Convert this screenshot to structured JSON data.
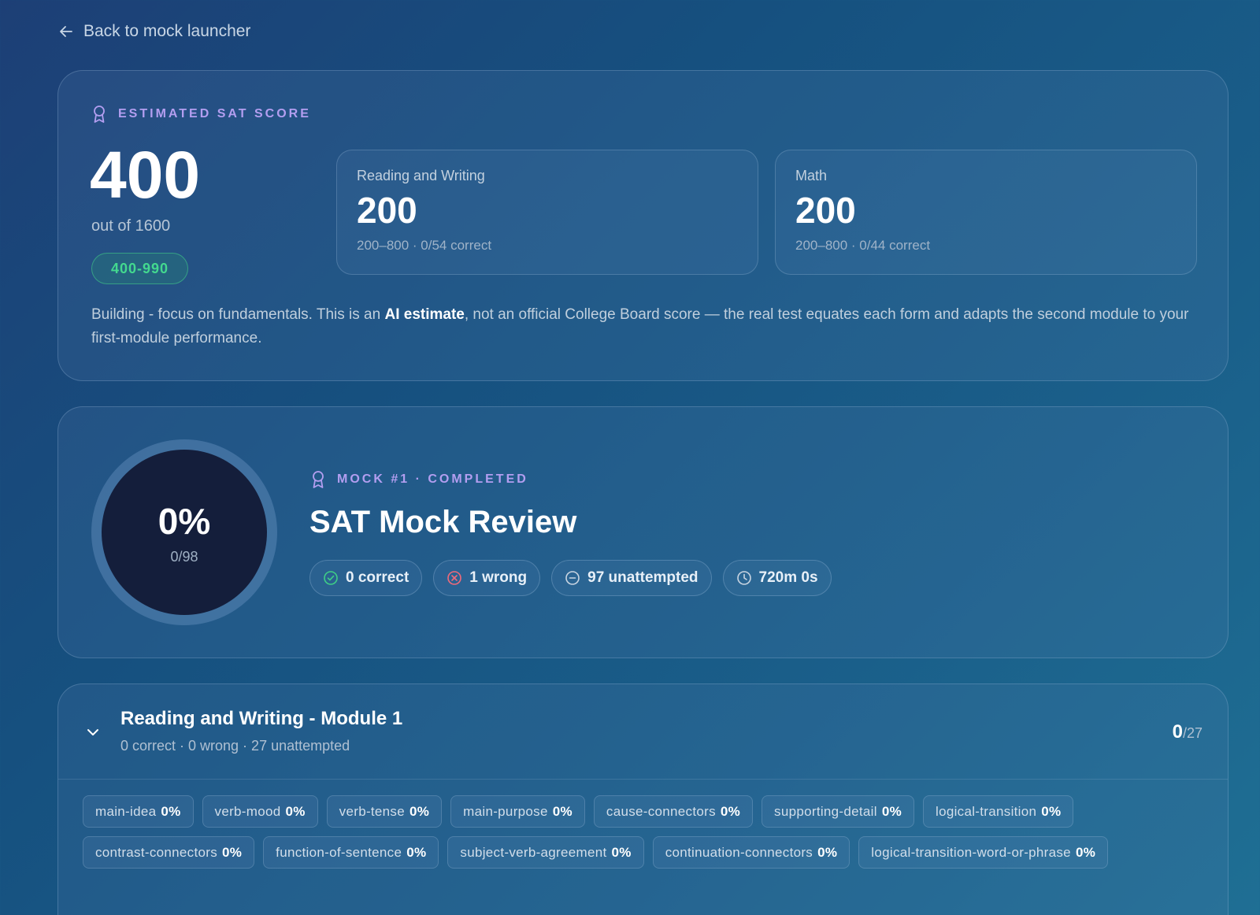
{
  "nav": {
    "back_label": "Back to mock launcher"
  },
  "score": {
    "eyebrow": "ESTIMATED SAT SCORE",
    "total": "400",
    "out_of": "out of 1600",
    "band": "400-990",
    "sections": [
      {
        "label": "Reading and Writing",
        "score": "200",
        "detail": "200–800 · 0/54 correct"
      },
      {
        "label": "Math",
        "score": "200",
        "detail": "200–800 · 0/44 correct"
      }
    ],
    "disclaimer_prefix": "Building - focus on fundamentals. This is an ",
    "disclaimer_bold": "AI estimate",
    "disclaimer_suffix": ", not an official College Board score — the real test equates each form and adapts the second module to your first-module performance."
  },
  "mock": {
    "percent": "0%",
    "fraction": "0/98",
    "eyebrow": "MOCK #1 · COMPLETED",
    "title": "SAT Mock Review",
    "chips": [
      {
        "icon": "check-circle-icon",
        "label": "0 correct",
        "color": "#3ecf86"
      },
      {
        "icon": "x-circle-icon",
        "label": "1 wrong",
        "color": "#f06a7a"
      },
      {
        "icon": "minus-circle-icon",
        "label": "97 unattempted",
        "color": "#c9d5e2"
      },
      {
        "icon": "clock-icon",
        "label": "720m 0s",
        "color": "#c9d5e2"
      }
    ]
  },
  "module": {
    "title": "Reading and Writing - Module 1",
    "subtitle": "0 correct · 0 wrong · 27 unattempted",
    "score": "0",
    "score_total": "/27",
    "tags": [
      {
        "name": "main-idea",
        "pct": "0%"
      },
      {
        "name": "verb-mood",
        "pct": "0%"
      },
      {
        "name": "verb-tense",
        "pct": "0%"
      },
      {
        "name": "main-purpose",
        "pct": "0%"
      },
      {
        "name": "cause-connectors",
        "pct": "0%"
      },
      {
        "name": "supporting-detail",
        "pct": "0%"
      },
      {
        "name": "logical-transition",
        "pct": "0%"
      },
      {
        "name": "contrast-connectors",
        "pct": "0%"
      },
      {
        "name": "function-of-sentence",
        "pct": "0%"
      },
      {
        "name": "subject-verb-agreement",
        "pct": "0%"
      },
      {
        "name": "continuation-connectors",
        "pct": "0%"
      },
      {
        "name": "logical-transition-word-or-phrase",
        "pct": "0%"
      }
    ]
  },
  "colors": {
    "accent": "#b39ef0",
    "success": "#43d98f",
    "error": "#f06a7a"
  }
}
